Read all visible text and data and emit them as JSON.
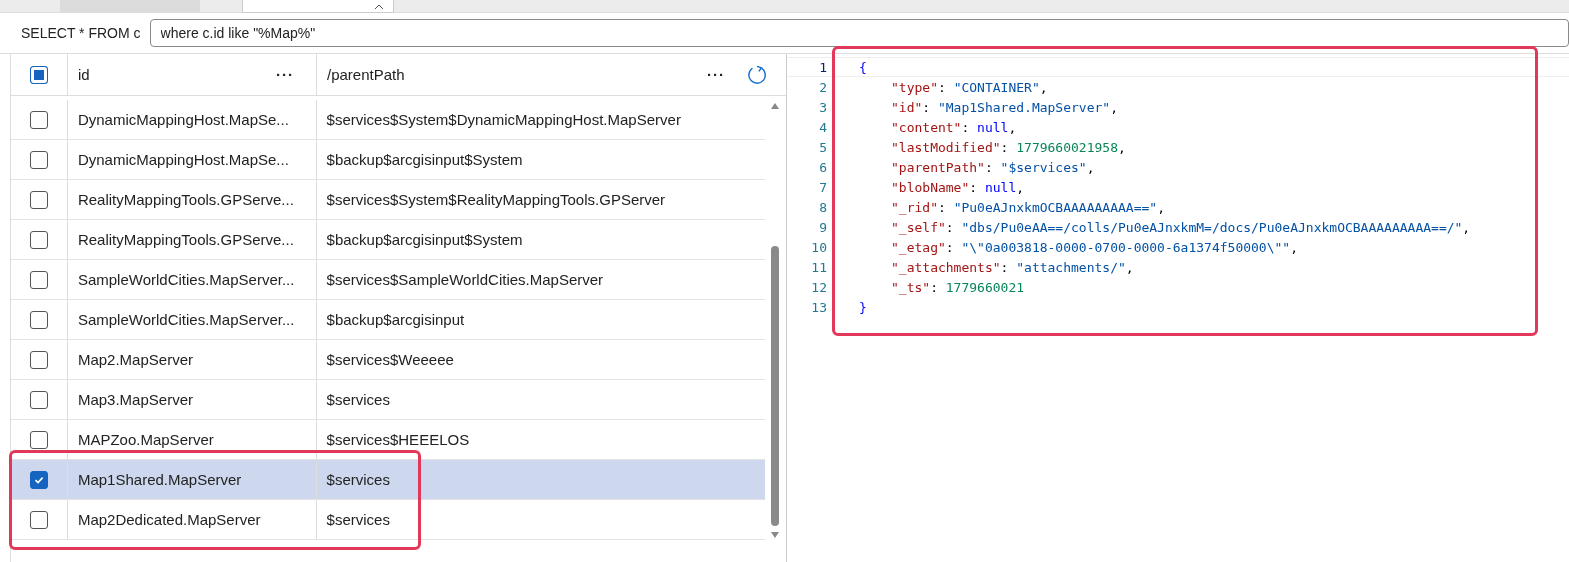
{
  "tabs": [
    {
      "selected": false
    },
    {
      "selected": true
    }
  ],
  "query": {
    "prefix": "SELECT * FROM c",
    "value": "where c.id like \"%Map%\""
  },
  "table": {
    "select_all_indeterminate": true,
    "columns": [
      {
        "label": "id",
        "menu": "···"
      },
      {
        "label": "/parentPath",
        "menu": "···"
      }
    ],
    "rows": [
      {
        "id": "DynamicMappingHost.MapSe...",
        "parentPath": "$services$System$DynamicMappingHost.MapServer",
        "selected": false
      },
      {
        "id": "DynamicMappingHost.MapSe...",
        "parentPath": "$backup$arcgisinput$System",
        "selected": false
      },
      {
        "id": "RealityMappingTools.GPServe...",
        "parentPath": "$services$System$RealityMappingTools.GPServer",
        "selected": false
      },
      {
        "id": "RealityMappingTools.GPServe...",
        "parentPath": "$backup$arcgisinput$System",
        "selected": false
      },
      {
        "id": "SampleWorldCities.MapServer...",
        "parentPath": "$services$SampleWorldCities.MapServer",
        "selected": false
      },
      {
        "id": "SampleWorldCities.MapServer...",
        "parentPath": "$backup$arcgisinput",
        "selected": false
      },
      {
        "id": "Map2.MapServer",
        "parentPath": "$services$Weeeee",
        "selected": false
      },
      {
        "id": "Map3.MapServer",
        "parentPath": "$services",
        "selected": false
      },
      {
        "id": "MAPZoo.MapServer",
        "parentPath": "$services$HEEELOS",
        "selected": false
      },
      {
        "id": "Map1Shared.MapServer",
        "parentPath": "$services",
        "selected": true
      },
      {
        "id": "Map2Dedicated.MapServer",
        "parentPath": "$services",
        "selected": false
      }
    ]
  },
  "editor": {
    "lines": [
      {
        "number": "1",
        "tokens": [
          {
            "kind": "brace",
            "text": "{"
          }
        ],
        "children": [
          {
            "number": "2",
            "tokens": [
              {
                "kind": "key",
                "text": "\"type\""
              },
              {
                "kind": "punct",
                "text": ": "
              },
              {
                "kind": "string",
                "text": "\"CONTAINER\""
              },
              {
                "kind": "punct",
                "text": ","
              }
            ]
          },
          {
            "number": "3",
            "tokens": [
              {
                "kind": "key",
                "text": "\"id\""
              },
              {
                "kind": "punct",
                "text": ": "
              },
              {
                "kind": "string",
                "text": "\"Map1Shared.MapServer\""
              },
              {
                "kind": "punct",
                "text": ","
              }
            ]
          },
          {
            "number": "4",
            "tokens": [
              {
                "kind": "key",
                "text": "\"content\""
              },
              {
                "kind": "punct",
                "text": ": "
              },
              {
                "kind": "null",
                "text": "null"
              },
              {
                "kind": "punct",
                "text": ","
              }
            ]
          },
          {
            "number": "5",
            "tokens": [
              {
                "kind": "key",
                "text": "\"lastModified\""
              },
              {
                "kind": "punct",
                "text": ": "
              },
              {
                "kind": "number",
                "text": "1779660021958"
              },
              {
                "kind": "punct",
                "text": ","
              }
            ]
          },
          {
            "number": "6",
            "tokens": [
              {
                "kind": "key",
                "text": "\"parentPath\""
              },
              {
                "kind": "punct",
                "text": ": "
              },
              {
                "kind": "string",
                "text": "\"$services\""
              },
              {
                "kind": "punct",
                "text": ","
              }
            ]
          },
          {
            "number": "7",
            "tokens": [
              {
                "kind": "key",
                "text": "\"blobName\""
              },
              {
                "kind": "punct",
                "text": ": "
              },
              {
                "kind": "null",
                "text": "null"
              },
              {
                "kind": "punct",
                "text": ","
              }
            ]
          },
          {
            "number": "8",
            "tokens": [
              {
                "kind": "key",
                "text": "\"_rid\""
              },
              {
                "kind": "punct",
                "text": ": "
              },
              {
                "kind": "string",
                "text": "\"Pu0eAJnxkmOCBAAAAAAAAA==\""
              },
              {
                "kind": "punct",
                "text": ","
              }
            ]
          },
          {
            "number": "9",
            "tokens": [
              {
                "kind": "key",
                "text": "\"_self\""
              },
              {
                "kind": "punct",
                "text": ": "
              },
              {
                "kind": "string",
                "text": "\"dbs/Pu0eAA==/colls/Pu0eAJnxkmM=/docs/Pu0eAJnxkmOCBAAAAAAAAA==/\""
              },
              {
                "kind": "punct",
                "text": ","
              }
            ]
          },
          {
            "number": "10",
            "tokens": [
              {
                "kind": "key",
                "text": "\"_etag\""
              },
              {
                "kind": "punct",
                "text": ": "
              },
              {
                "kind": "string",
                "text": "\"\\\"0a003818-0000-0700-0000-6a1374f50000\\\"\""
              },
              {
                "kind": "punct",
                "text": ","
              }
            ]
          },
          {
            "number": "11",
            "tokens": [
              {
                "kind": "key",
                "text": "\"_attachments\""
              },
              {
                "kind": "punct",
                "text": ": "
              },
              {
                "kind": "string",
                "text": "\"attachments/\""
              },
              {
                "kind": "punct",
                "text": ","
              }
            ]
          },
          {
            "number": "12",
            "tokens": [
              {
                "kind": "key",
                "text": "\"_ts\""
              },
              {
                "kind": "punct",
                "text": ": "
              },
              {
                "kind": "number",
                "text": "1779660021"
              }
            ]
          }
        ]
      },
      {
        "number": "13",
        "tokens": [
          {
            "kind": "brace",
            "text": "}"
          }
        ]
      }
    ]
  }
}
